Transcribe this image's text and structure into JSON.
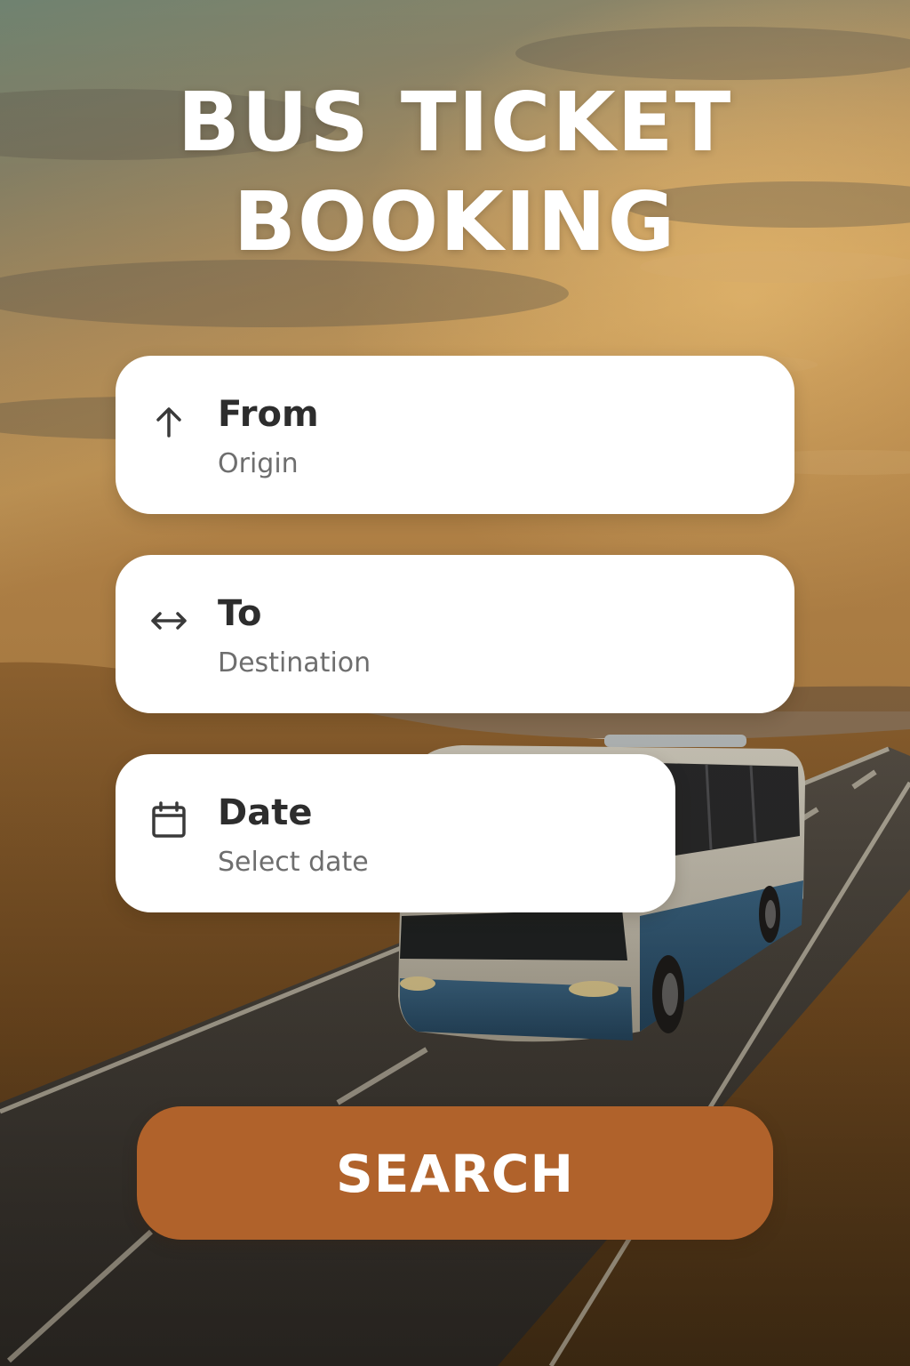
{
  "title_lines": [
    "BUS TICKET",
    "BOOKING"
  ],
  "fields": {
    "from": {
      "label": "From",
      "placeholder": "Origin",
      "icon": "arrow-up-icon"
    },
    "to": {
      "label": "To",
      "placeholder": "Destination",
      "icon": "arrow-left-right-icon"
    },
    "date": {
      "label": "Date",
      "placeholder": "Select date",
      "icon": "calendar-icon"
    }
  },
  "search_button": {
    "label": "SEARCH"
  },
  "colors": {
    "accent": "#b0622b",
    "card_background": "#ffffff",
    "label_text": "#2d2d2d",
    "placeholder_text": "#6e6e6e",
    "title_text": "#ffffff"
  }
}
